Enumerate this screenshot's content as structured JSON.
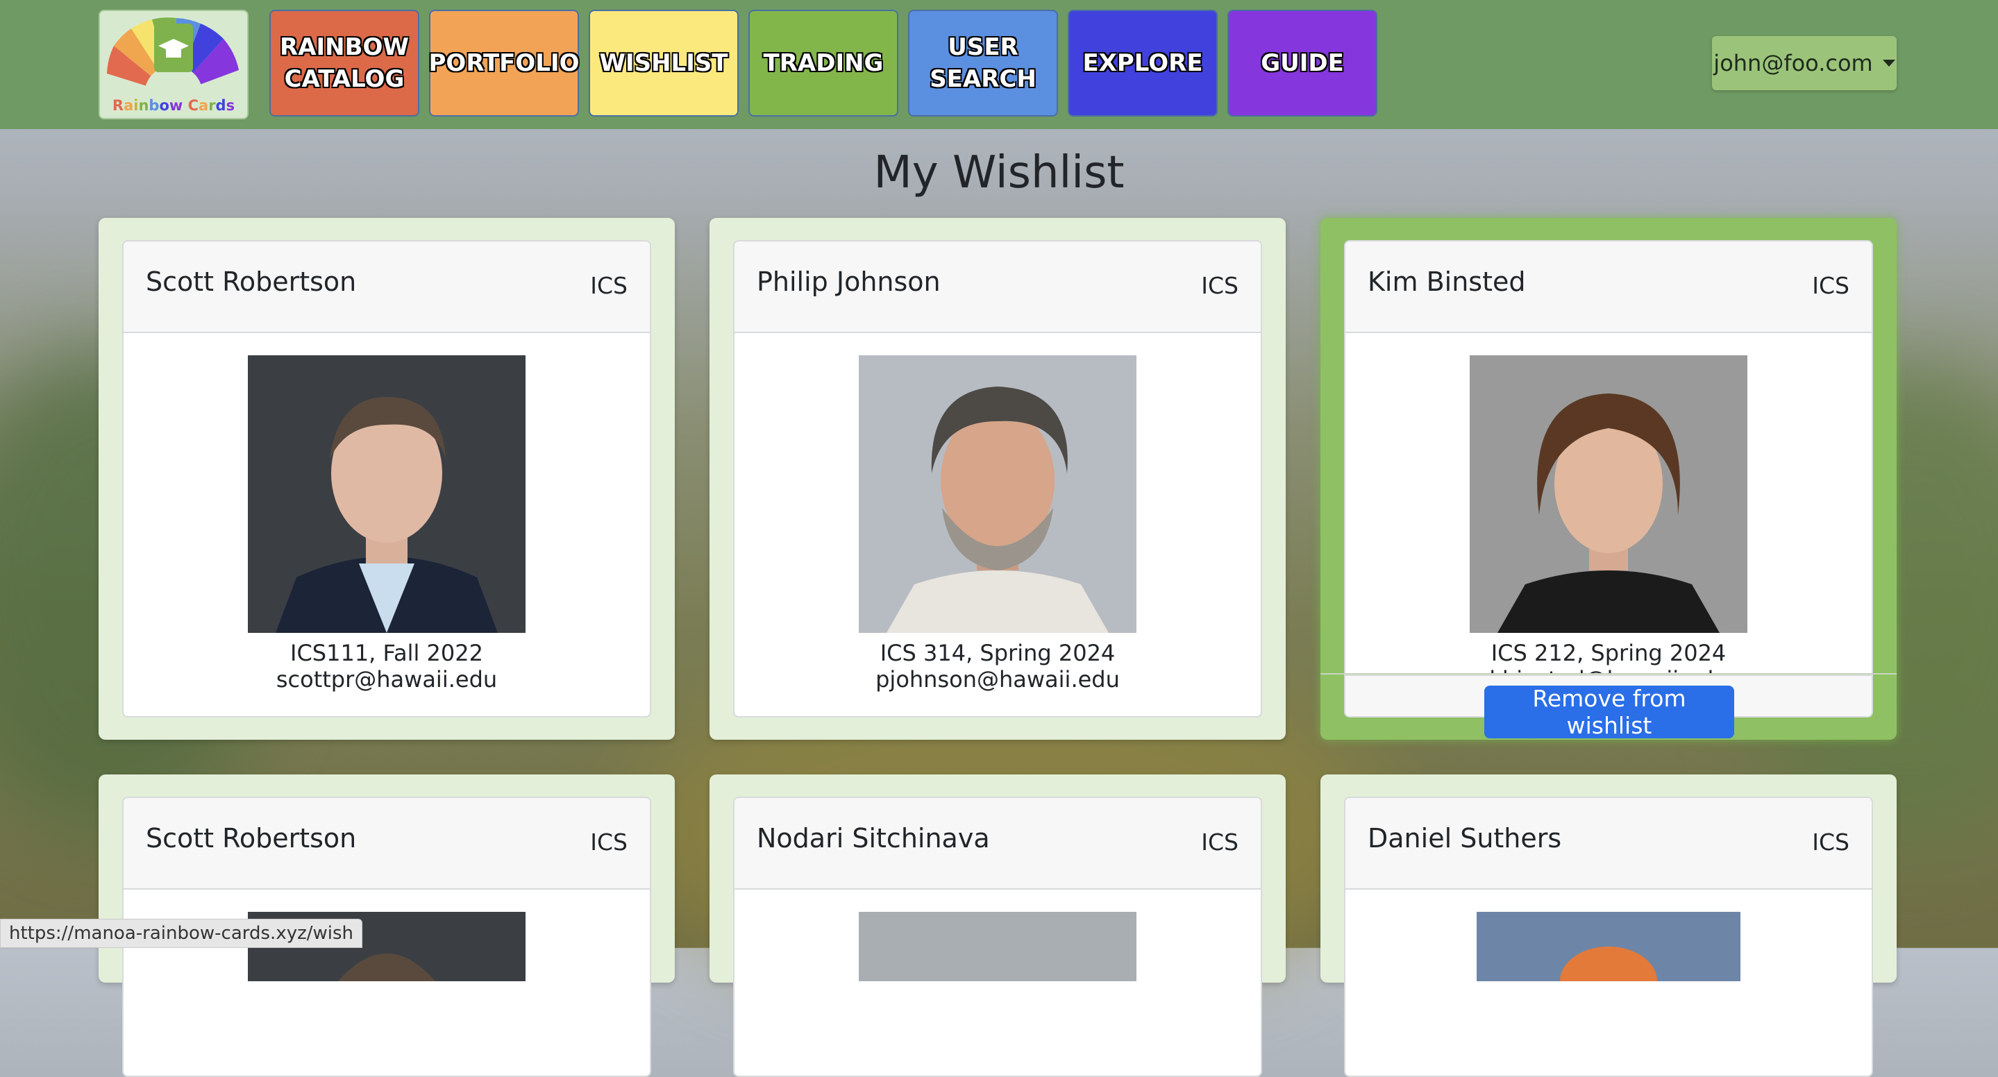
{
  "nav": {
    "logo_text": "Rainbow Cards",
    "items": [
      {
        "label": "RAINBOW\nCATALOG",
        "color": "#dc6a48"
      },
      {
        "label": "PORTFOLIO",
        "color": "#f2a356"
      },
      {
        "label": "WISHLIST",
        "color": "#fbe97d"
      },
      {
        "label": "TRADING",
        "color": "#83b64a"
      },
      {
        "label": "USER\nSEARCH",
        "color": "#5b8fe0"
      },
      {
        "label": "EXPLORE",
        "color": "#4142dd"
      },
      {
        "label": "GUIDE",
        "color": "#8636dd"
      }
    ],
    "user": "john@foo.com"
  },
  "page": {
    "title": "My Wishlist"
  },
  "cards": [
    {
      "name": "Scott Robertson",
      "dept": "ICS",
      "line1": "ICS111, Fall 2022",
      "line2": "scottpr@hawaii.edu"
    },
    {
      "name": "Philip Johnson",
      "dept": "ICS",
      "line1": "ICS 314, Spring 2024",
      "line2": "pjohnson@hawaii.edu"
    },
    {
      "name": "Kim Binsted",
      "dept": "ICS",
      "line1": "ICS 212, Spring 2024",
      "line2": "kbinsted@hawaii.edu",
      "action": "Remove from wishlist"
    },
    {
      "name": "Scott Robertson",
      "dept": "ICS"
    },
    {
      "name": "Nodari Sitchinava",
      "dept": "ICS"
    },
    {
      "name": "Daniel Suthers",
      "dept": "ICS"
    }
  ],
  "status_url": "https://manoa-rainbow-cards.xyz/wish"
}
